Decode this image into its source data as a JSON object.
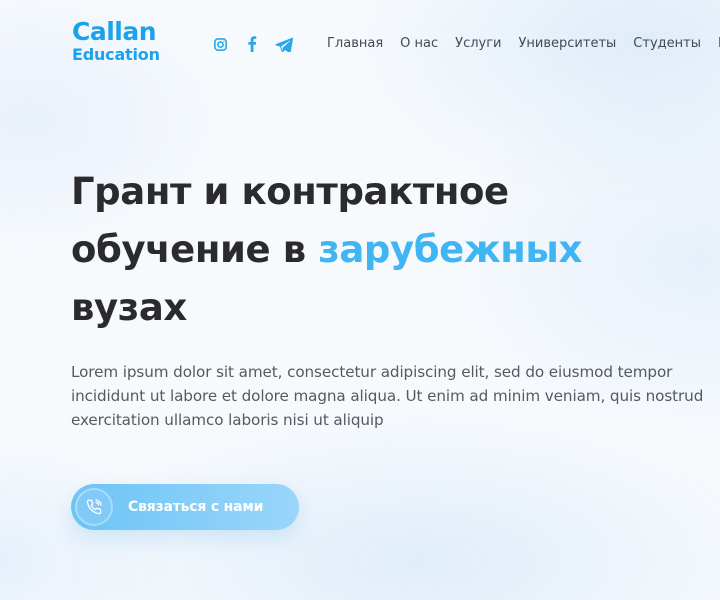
{
  "logo": {
    "line1": "Callan",
    "line2": "Education"
  },
  "socials": [
    "instagram-icon",
    "facebook-icon",
    "telegram-icon"
  ],
  "colors": {
    "brand": "#1aa3ec",
    "accent": "#3fb5f3",
    "text_dark": "#2b2b2e",
    "text_body": "#565a60",
    "button_start": "#6cc4f6",
    "button_end": "#9ad6fa"
  },
  "nav": {
    "items": [
      {
        "label": "Главная"
      },
      {
        "label": "О нас"
      },
      {
        "label": "Услуги"
      },
      {
        "label": "Университеты"
      },
      {
        "label": "Студенты"
      },
      {
        "label": "К"
      }
    ]
  },
  "hero": {
    "title_part1": "Грант и контрактное обучение в ",
    "title_accent": "зарубежных",
    "title_part2": "вузах",
    "description": "Lorem ipsum dolor sit amet, consectetur adipiscing elit, sed do eiusmod tempor incididunt ut labore et dolore magna aliqua. Ut enim ad minim veniam, quis nostrud exercitation ullamco laboris nisi ut aliquip",
    "cta_label": "Связаться с нами",
    "cta_icon": "phone-icon"
  }
}
